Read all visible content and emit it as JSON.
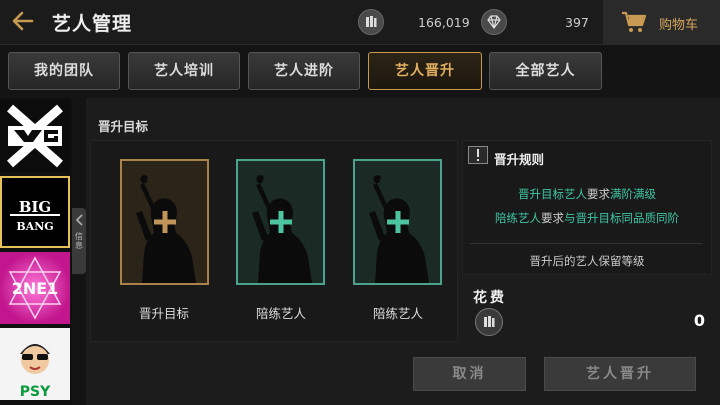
{
  "header": {
    "back_icon": "arrow-left-icon",
    "title": "艺人管理",
    "gold_icon": "currency-bars-icon",
    "gold_value": "166,019",
    "diamond_icon": "diamond-icon",
    "diamond_value": "397",
    "cart_icon": "shopping-cart-icon",
    "cart_label": "购物车"
  },
  "tabs": [
    {
      "label": "我的团队",
      "active": false
    },
    {
      "label": "艺人培训",
      "active": false
    },
    {
      "label": "艺人进阶",
      "active": false
    },
    {
      "label": "艺人晋升",
      "active": true
    },
    {
      "label": "全部艺人",
      "active": false
    }
  ],
  "sidebar": {
    "items": [
      {
        "name": "YG",
        "logo": "yg-logo"
      },
      {
        "name": "BIGBANG",
        "logo": "bigbang-logo",
        "selected": true
      },
      {
        "name": "2NE1",
        "logo": "2ne1-logo"
      },
      {
        "name": "PSY",
        "logo": "psy-logo"
      }
    ],
    "handle_label": "信息"
  },
  "promotion": {
    "section_title": "晋升目标",
    "slots": [
      {
        "label": "晋升目标",
        "style": "gold",
        "icon": "plus-icon"
      },
      {
        "label": "陪练艺人",
        "style": "teal",
        "icon": "plus-icon"
      },
      {
        "label": "陪练艺人",
        "style": "teal",
        "icon": "plus-icon"
      }
    ]
  },
  "rules": {
    "icon": "exclamation-icon",
    "title": "晋升规则",
    "line1_a": "晋升目标艺人",
    "line1_b": "要求",
    "line1_c": "满阶满级",
    "line2_a": "陪练艺人",
    "line2_b": "要求",
    "line2_c": "与晋升目标同品质同阶",
    "line3": "晋升后的艺人保留等级"
  },
  "cost": {
    "label": "花费",
    "icon": "currency-bars-icon",
    "value": "0"
  },
  "buttons": {
    "cancel": "取消",
    "promote": "艺人晋升"
  },
  "colors": {
    "accent_gold": "#d4a55a",
    "accent_teal": "#3fc6a2",
    "background": "#141414"
  }
}
